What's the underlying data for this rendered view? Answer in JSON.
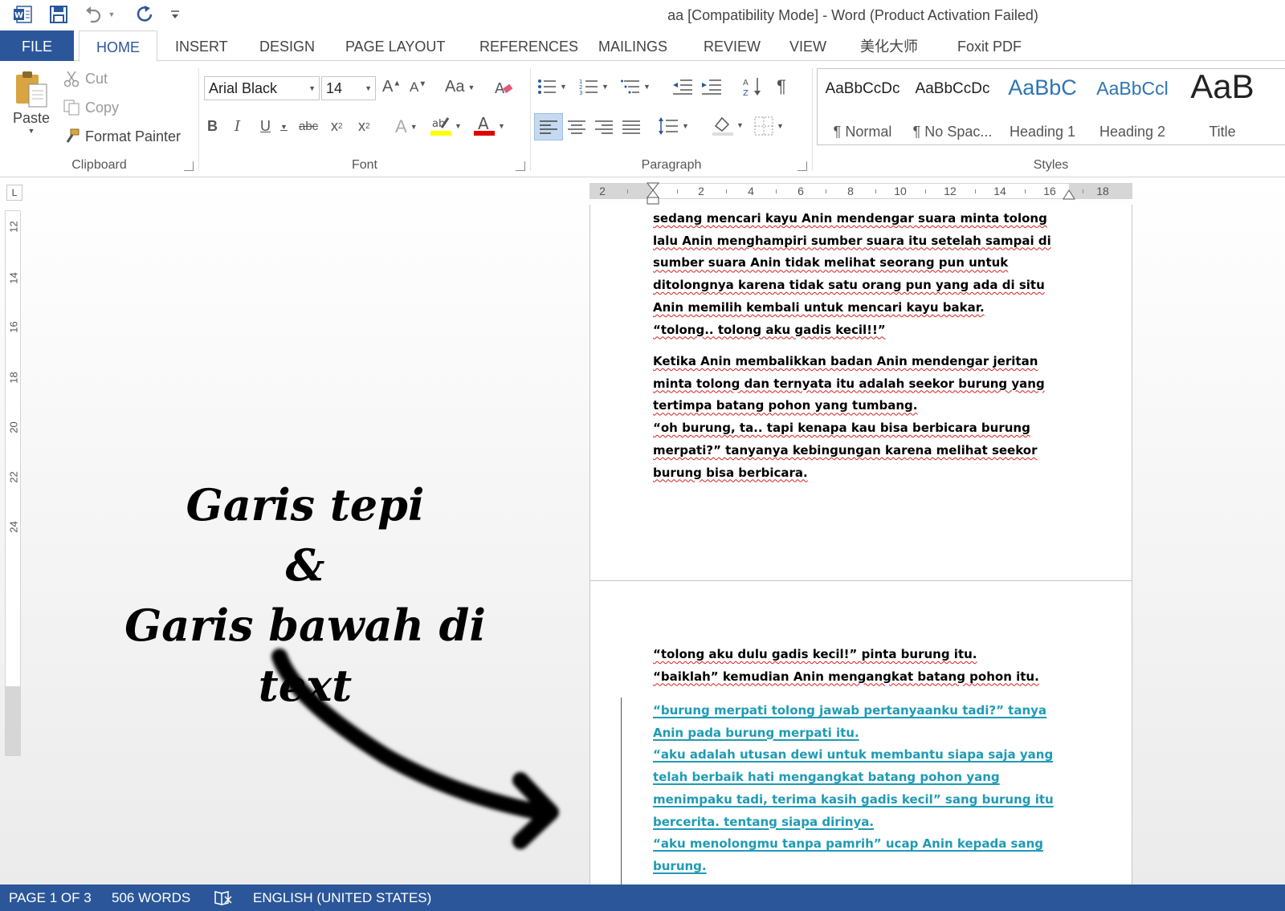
{
  "window": {
    "title": "aa [Compatibility Mode] - Word (Product Activation Failed)"
  },
  "quick_access": {
    "icons": [
      "word-icon",
      "save-icon",
      "undo-icon",
      "redo-icon",
      "customize-icon"
    ]
  },
  "tabs": [
    {
      "label": "FILE"
    },
    {
      "label": "HOME",
      "active": true
    },
    {
      "label": "INSERT"
    },
    {
      "label": "DESIGN"
    },
    {
      "label": "PAGE LAYOUT"
    },
    {
      "label": "REFERENCES"
    },
    {
      "label": "MAILINGS"
    },
    {
      "label": "REVIEW"
    },
    {
      "label": "VIEW"
    },
    {
      "label": "美化大师"
    },
    {
      "label": "Foxit PDF"
    }
  ],
  "clipboard": {
    "label": "Clipboard",
    "paste": "Paste",
    "cut": "Cut",
    "copy": "Copy",
    "format_painter": "Format Painter"
  },
  "font": {
    "label": "Font",
    "name": "Arial Black",
    "size": "14",
    "change_case": "Aa",
    "bold": "B",
    "italic": "I",
    "underline": "U",
    "strikethrough": "abc",
    "subscript": "x",
    "superscript": "x"
  },
  "paragraph": {
    "label": "Paragraph",
    "show_marks": "¶"
  },
  "styles": {
    "label": "Styles",
    "items": [
      {
        "sample": "AaBbCcDc",
        "name": "¶ Normal"
      },
      {
        "sample": "AaBbCcDc",
        "name": "¶ No Spac..."
      },
      {
        "sample": "AaBbC",
        "name": "Heading 1"
      },
      {
        "sample": "AaBbCcl",
        "name": "Heading 2"
      },
      {
        "sample": "AaB",
        "name": "Title"
      }
    ]
  },
  "ruler": {
    "horizontal": [
      "2",
      "2",
      "4",
      "6",
      "8",
      "10",
      "12",
      "14",
      "16",
      "18"
    ],
    "vertical": [
      "12",
      "14",
      "16",
      "18",
      "20",
      "22",
      "24"
    ]
  },
  "document": {
    "page1": [
      [
        "sedang mencari kayu Anin mendengar suara minta tolong",
        "lalu Anin menghampiri sumber suara itu setelah sampai di",
        "sumber suara Anin tidak melihat seorang pun untuk",
        "ditolongnya karena tidak satu orang pun yang ada di situ",
        "Anin memilih kembali untuk mencari kayu bakar.",
        "“tolong.. tolong aku gadis kecil!!”"
      ],
      [
        "Ketika Anin membalikkan badan Anin mendengar jeritan",
        "minta tolong dan ternyata itu adalah seekor burung yang",
        "tertimpa batang pohon yang tumbang.",
        "“oh burung, ta.. tapi kenapa kau bisa berbicara burung",
        "merpati?” tanyanya kebingungan karena melihat seekor",
        "burung bisa berbicara."
      ]
    ],
    "page2_normal": [
      "“tolong aku dulu gadis kecil!” pinta burung itu.",
      "“baiklah” kemudian Anin mengangkat batang pohon itu."
    ],
    "page2_blue": [
      "“burung merpati tolong jawab pertanyaanku tadi?” tanya",
      "Anin pada burung merpati itu.",
      "“aku adalah utusan dewi untuk membantu siapa saja yang",
      "telah berbaik hati mengangkat batang pohon yang",
      "menimpaku tadi, terima kasih gadis kecil” sang burung itu",
      "bercerita. tentang siapa dirinya.",
      "“aku menolongmu tanpa pamrih” ucap Anin kepada sang",
      "burung."
    ]
  },
  "annotation": {
    "line1": "Garis tepi",
    "line2": "&",
    "line3": "Garis bawah di text"
  },
  "status": {
    "page": "PAGE 1 OF 3",
    "words": "506 WORDS",
    "language": "ENGLISH (UNITED STATES)"
  },
  "colors": {
    "accent": "#2b579a",
    "underline_blue": "#1f9bb4",
    "spellcheck_red": "#d32020"
  }
}
